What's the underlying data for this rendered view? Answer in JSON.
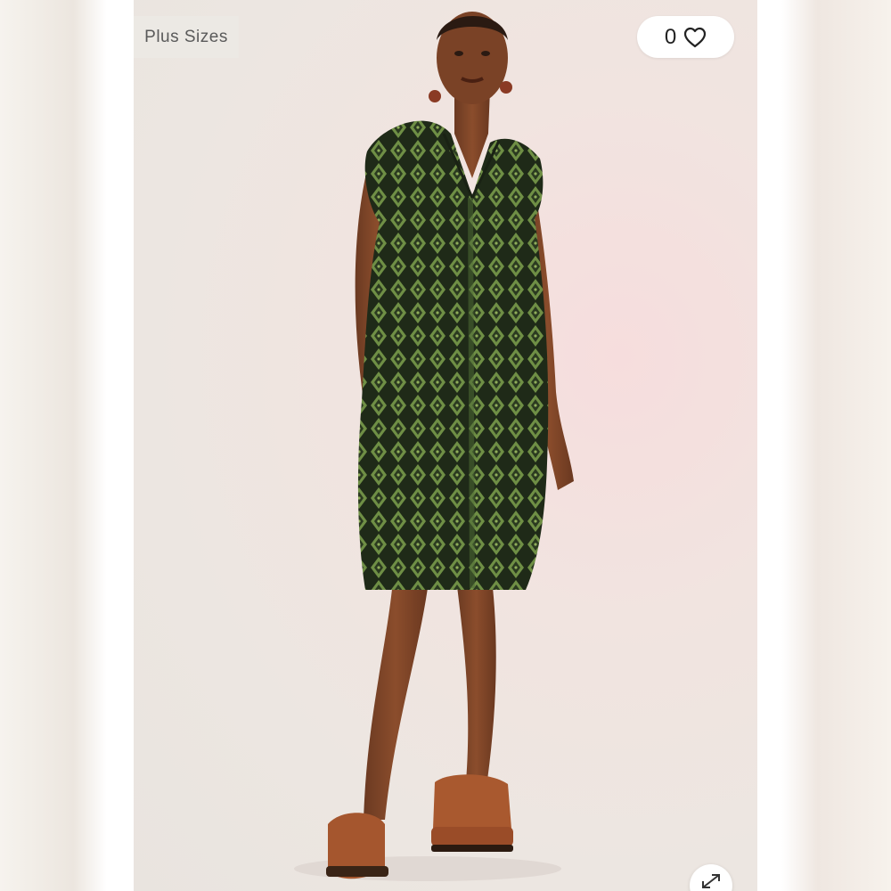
{
  "badge": {
    "label": "Plus Sizes"
  },
  "likes": {
    "count": "0",
    "icon": "heart-icon"
  },
  "expand": {
    "icon": "expand-icon"
  },
  "photo": {
    "subject": "model-in-green-snake-print-dress",
    "dress_color": "#3f5b2e",
    "background_color": "#ece6e1"
  }
}
